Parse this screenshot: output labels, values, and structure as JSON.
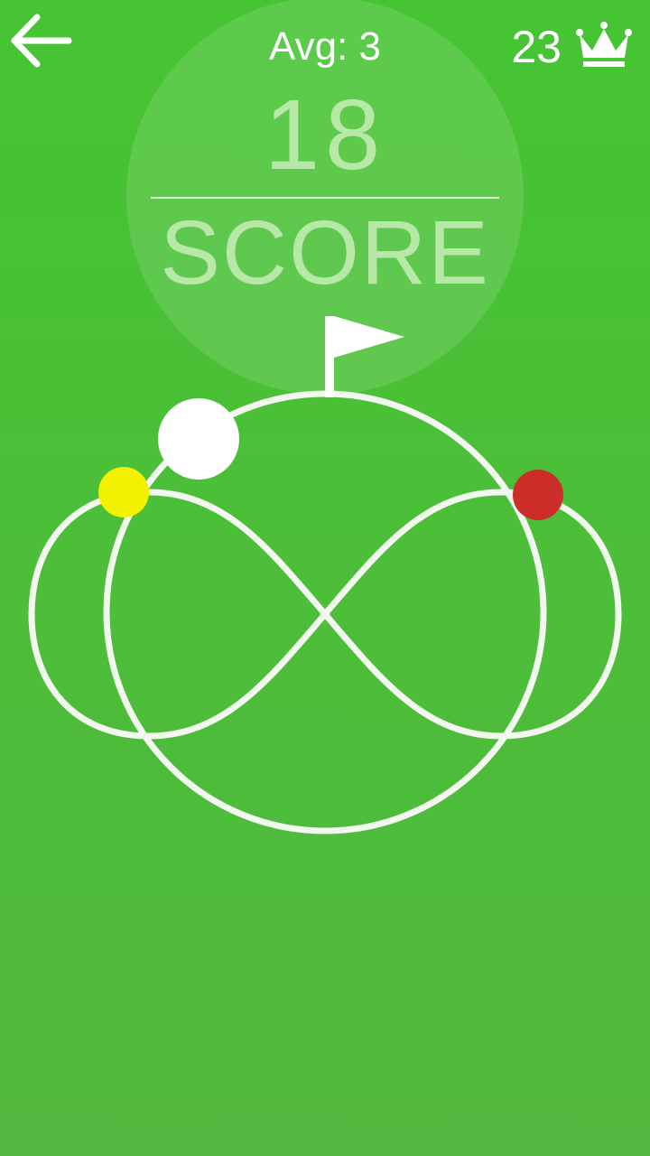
{
  "hud": {
    "avg_text": "Avg: 3",
    "best_score": "23",
    "score_value": "18",
    "score_label": "SCORE"
  },
  "icons": {
    "back": "arrow-left-icon",
    "best": "crown-icon",
    "goal": "flag-icon"
  },
  "colors": {
    "background_top": "#46c433",
    "background_bottom": "#52b83f",
    "track": "#f2f7ef",
    "player_ball": "#ffffff",
    "yellow_ball": "#f2f200",
    "red_ball": "#cc2e2a",
    "score_text": "#b8e8a8"
  }
}
